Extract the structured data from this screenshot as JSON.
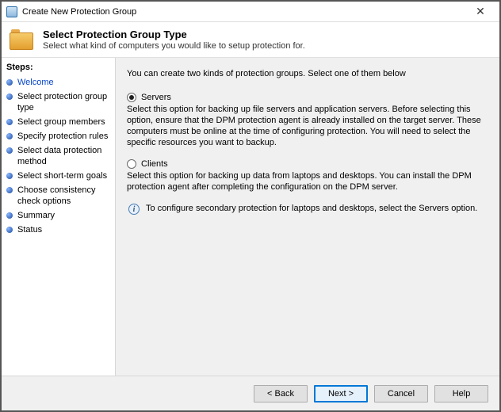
{
  "window": {
    "title": "Create New Protection Group",
    "close_glyph": "✕"
  },
  "header": {
    "heading": "Select Protection Group Type",
    "sub": "Select what kind of computers you would like to setup protection for."
  },
  "sidebar": {
    "title": "Steps:",
    "items": [
      {
        "label": "Welcome",
        "kind": "link"
      },
      {
        "label": "Select protection group type",
        "kind": "active"
      },
      {
        "label": "Select group members",
        "kind": "normal"
      },
      {
        "label": "Specify protection rules",
        "kind": "normal"
      },
      {
        "label": "Select data protection method",
        "kind": "normal"
      },
      {
        "label": "Select short-term goals",
        "kind": "normal"
      },
      {
        "label": "Choose consistency check options",
        "kind": "normal"
      },
      {
        "label": "Summary",
        "kind": "normal"
      },
      {
        "label": "Status",
        "kind": "normal"
      }
    ]
  },
  "content": {
    "intro": "You can create two kinds of protection groups. Select one of them below",
    "options": {
      "servers": {
        "label": "Servers",
        "selected": true,
        "desc": "Select this option for backing up file servers and application servers. Before selecting this option, ensure that the DPM protection agent is already installed on the target server. These computers must be online at the time of configuring protection. You will need to select the specific resources you want to backup."
      },
      "clients": {
        "label": "Clients",
        "selected": false,
        "desc": "Select this option for backing up data from laptops and desktops. You can install the DPM protection agent after completing the configuration on the DPM server."
      }
    },
    "info": "To configure secondary protection for laptops and desktops, select the Servers option."
  },
  "footer": {
    "back": "< Back",
    "next": "Next >",
    "cancel": "Cancel",
    "help": "Help"
  }
}
